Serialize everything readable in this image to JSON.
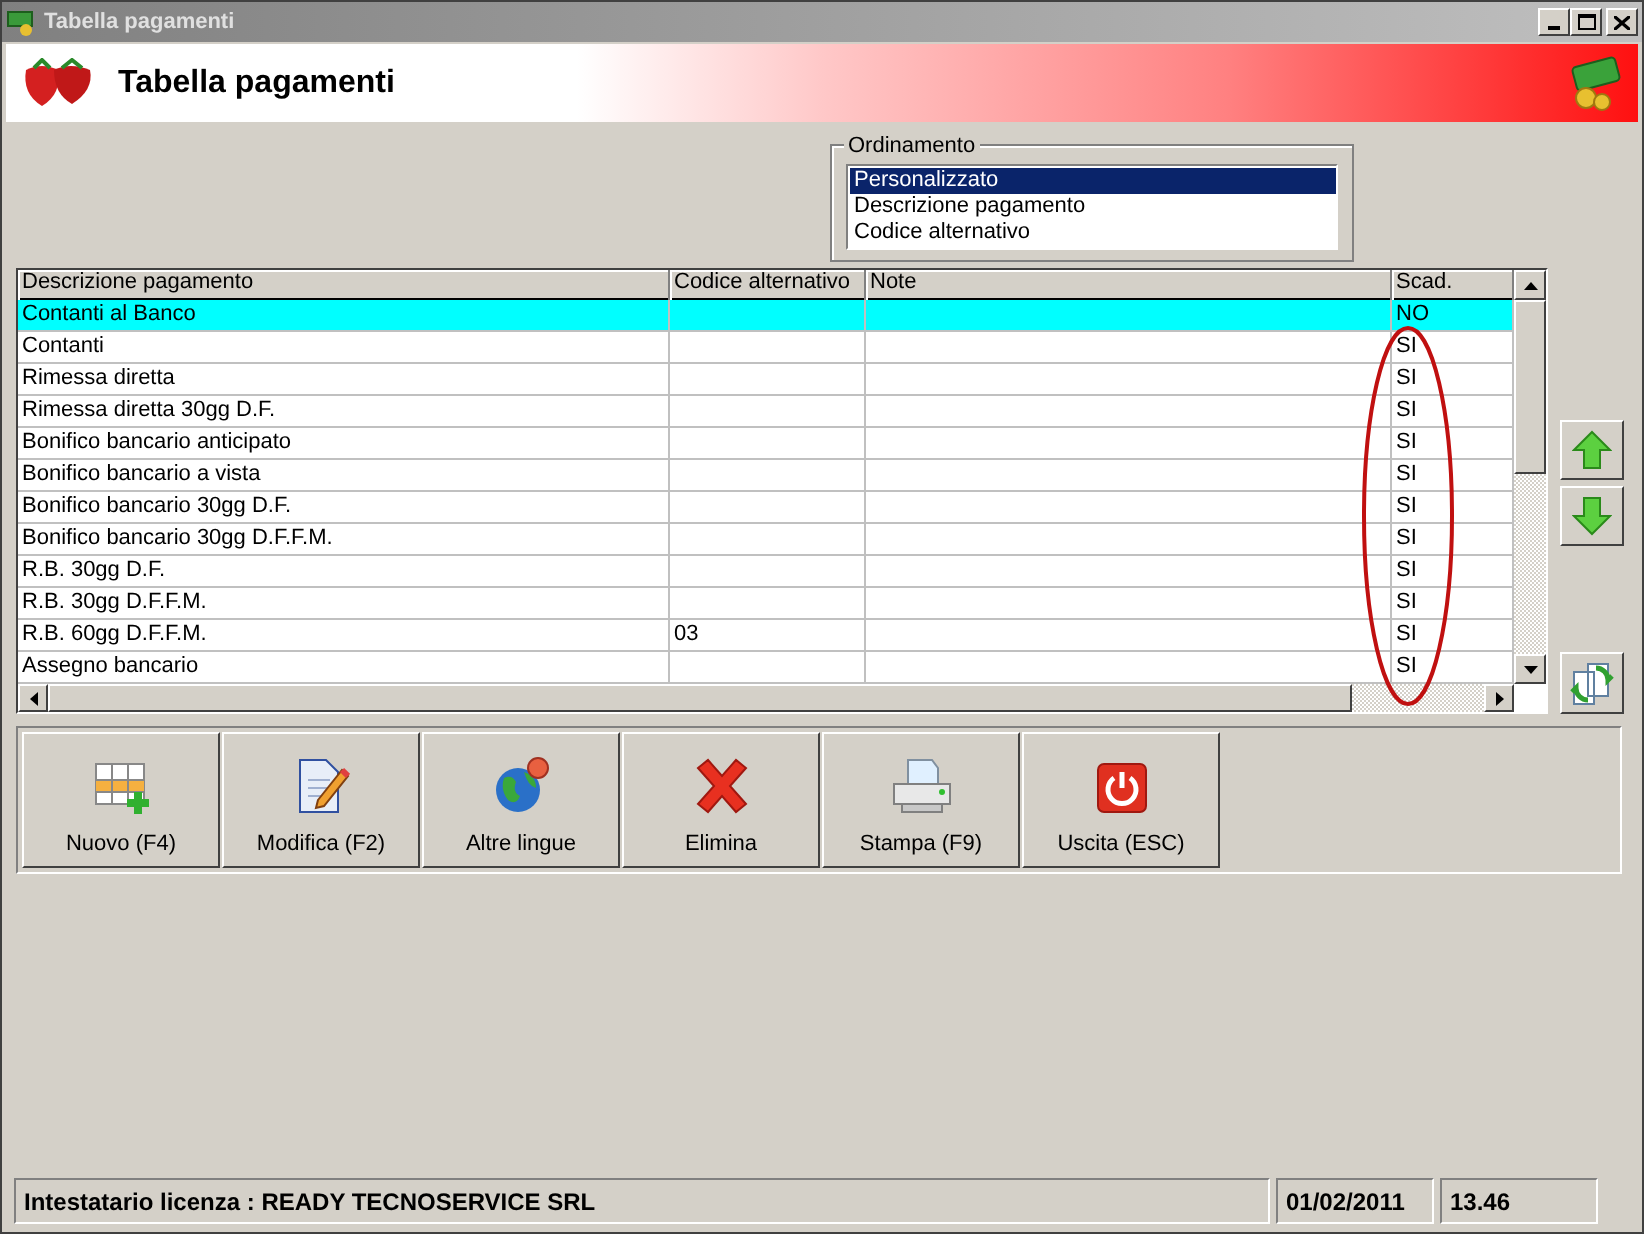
{
  "window": {
    "title": "Tabella pagamenti"
  },
  "header": {
    "title": "Tabella pagamenti"
  },
  "ordering": {
    "label": "Ordinamento",
    "options": [
      {
        "label": "Personalizzato",
        "selected": true
      },
      {
        "label": "Descrizione pagamento",
        "selected": false
      },
      {
        "label": "Codice alternativo",
        "selected": false
      }
    ]
  },
  "table": {
    "columns": [
      "Descrizione pagamento",
      "Codice alternativo",
      "Note",
      "Scad."
    ],
    "rows": [
      {
        "cells": [
          "Contanti al Banco",
          "",
          "",
          "NO"
        ],
        "selected": true
      },
      {
        "cells": [
          "Contanti",
          "",
          "",
          "SI"
        ],
        "selected": false
      },
      {
        "cells": [
          "Rimessa diretta",
          "",
          "",
          "SI"
        ],
        "selected": false
      },
      {
        "cells": [
          "Rimessa diretta 30gg D.F.",
          "",
          "",
          "SI"
        ],
        "selected": false
      },
      {
        "cells": [
          "Bonifico bancario anticipato",
          "",
          "",
          "SI"
        ],
        "selected": false
      },
      {
        "cells": [
          "Bonifico bancario a vista",
          "",
          "",
          "SI"
        ],
        "selected": false
      },
      {
        "cells": [
          "Bonifico bancario 30gg D.F.",
          "",
          "",
          "SI"
        ],
        "selected": false
      },
      {
        "cells": [
          "Bonifico bancario 30gg D.F.F.M.",
          "",
          "",
          "SI"
        ],
        "selected": false
      },
      {
        "cells": [
          "R.B. 30gg D.F.",
          "",
          "",
          "SI"
        ],
        "selected": false
      },
      {
        "cells": [
          "R.B. 30gg D.F.F.M.",
          "",
          "",
          "SI"
        ],
        "selected": false
      },
      {
        "cells": [
          "R.B. 60gg D.F.F.M.",
          "03",
          "",
          "SI"
        ],
        "selected": false
      },
      {
        "cells": [
          "Assegno bancario",
          "",
          "",
          "SI"
        ],
        "selected": false
      }
    ]
  },
  "toolbar": [
    {
      "label": "Nuovo (F4)"
    },
    {
      "label": "Modifica (F2)"
    },
    {
      "label": "Altre lingue"
    },
    {
      "label": "Elimina"
    },
    {
      "label": "Stampa (F9)"
    },
    {
      "label": "Uscita (ESC)"
    }
  ],
  "status_bar": {
    "license": "Intestatario licenza : READY TECNOSERVICE SRL",
    "date": "01/02/2011",
    "time": "13.46"
  }
}
